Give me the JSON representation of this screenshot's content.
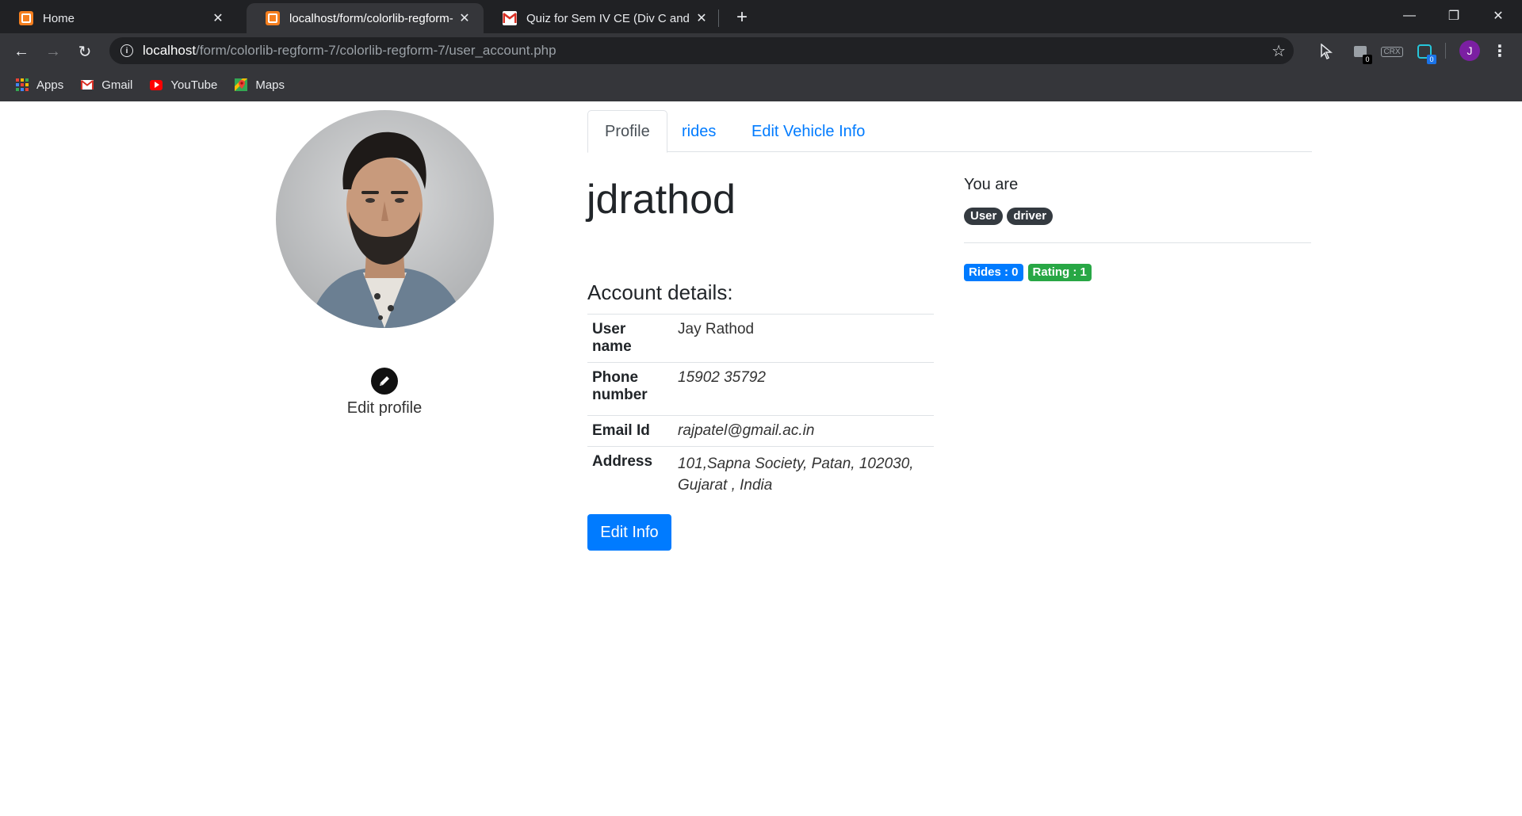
{
  "browser": {
    "tabs": [
      {
        "title": "Home",
        "active": false,
        "favicon": "xampp-icon"
      },
      {
        "title": "localhost/form/colorlib-regform-",
        "active": true,
        "favicon": "xampp-icon"
      },
      {
        "title": "Quiz for Sem IV CE (Div C and D)",
        "active": false,
        "favicon": "gmail-icon"
      }
    ],
    "url_host": "localhost",
    "url_path": "/form/colorlib-regform-7/colorlib-regform-7/user_account.php",
    "extensions": {
      "badge_1": "0",
      "crx_label": "CRX",
      "badge_2": "0"
    },
    "profile_initial": "J",
    "bookmarks": [
      {
        "label": "Apps",
        "icon": "apps-grid-icon"
      },
      {
        "label": "Gmail",
        "icon": "gmail-icon"
      },
      {
        "label": "YouTube",
        "icon": "youtube-icon"
      },
      {
        "label": "Maps",
        "icon": "maps-icon"
      }
    ]
  },
  "page": {
    "tabs": [
      "Profile",
      "rides",
      "Edit Vehicle Info"
    ],
    "username": "jdrathod",
    "edit_profile_label": "Edit profile",
    "account_heading": "Account details:",
    "details": [
      {
        "label": "User name",
        "value": "Jay Rathod"
      },
      {
        "label": "Phone number",
        "value": "15902 35792"
      },
      {
        "label": "Email Id",
        "value": "rajpatel@gmail.ac.in"
      },
      {
        "label": "Address",
        "value": "101,Sapna Society, Patan, 102030, Gujarat , India"
      }
    ],
    "edit_info_label": "Edit Info",
    "you_are_label": "You are",
    "roles": [
      "User",
      "driver"
    ],
    "stats": [
      {
        "label": "Rides : 0",
        "color": "#007bff"
      },
      {
        "label": "Rating : 1",
        "color": "#28a745"
      }
    ]
  },
  "colors": {
    "primary": "#007bff",
    "success": "#28a745",
    "dark": "#343a40",
    "chrome_dark": "#202124",
    "chrome_toolbar": "#35363a"
  }
}
